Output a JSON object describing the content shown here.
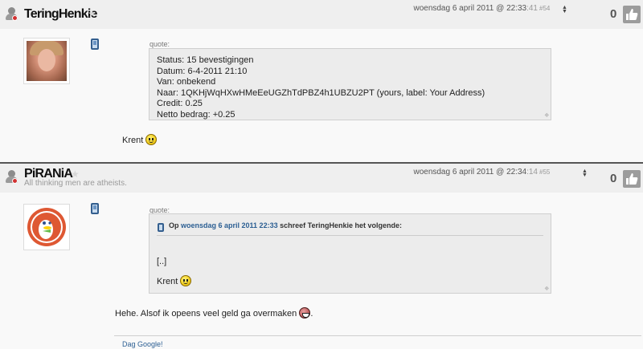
{
  "posts": [
    {
      "username": "TeringHenkie",
      "tagline": "",
      "date": "woensdag 6 april 2011 @ 22:33",
      "seconds": ":41",
      "post_number": "#54",
      "score": "0",
      "quote_label": "quote:",
      "quote_lines": [
        "Status: 15 bevestigingen",
        "Datum: 6-4-2011 21:10",
        "Van: onbekend",
        "Naar: 1QKHjWqHXwHMeEeUGZhTdPBZ4h1UBZU2PT (yours, label: Your Address)",
        "Credit: 0.25",
        "Netto bedrag: +0.25"
      ],
      "body_text": "Krent",
      "body_icon": "smiley-icon"
    },
    {
      "username": "PiRANiA",
      "tagline": "All thinking men are atheists.",
      "date": "woensdag 6 april 2011 @ 22:34",
      "seconds": ":14",
      "post_number": "#55",
      "score": "0",
      "quote_label": "quote:",
      "nested_quote": {
        "prefix": "Op",
        "date_link": "woensdag 6 april 2011 22:33",
        "suffix": "schreef TeringHenkie het volgende:",
        "lines": [
          "[..]",
          "Krent"
        ],
        "icon": "smiley-icon"
      },
      "body_text": "Hehe. Alsof ik opeens veel geld ga overmaken",
      "body_end": ".",
      "body_icon": "grin-icon",
      "signature_link": "Dag Google!"
    }
  ],
  "colors": {
    "header_bg": "#efefef",
    "body_bg": "#f9f9f9",
    "link": "#2c5f93",
    "quote_bg": "#ececec",
    "thumbs_button": "#9c9c9c"
  },
  "icons": [
    "user-icon",
    "star-icon",
    "sort-icon",
    "thumbs-up-icon",
    "phone-icon",
    "smiley-icon",
    "grin-icon",
    "resize-grip-icon"
  ]
}
